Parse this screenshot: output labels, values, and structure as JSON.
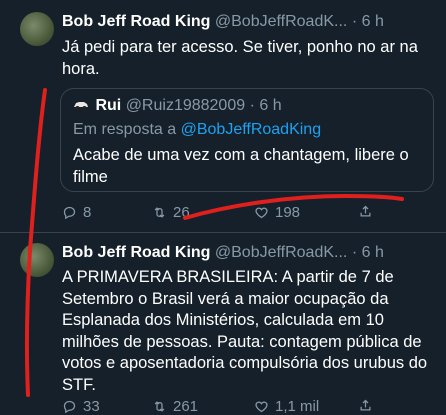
{
  "colors": {
    "background": "#15202b",
    "text": "#ffffff",
    "muted": "#8899a6",
    "accent": "#1da1f2",
    "scribble": "#e0201c"
  },
  "tweet1": {
    "name": "Bob Jeff Road King",
    "handle": "@BobJeffRoadK...",
    "dot": "·",
    "time": "6 h",
    "text": "Já pedi para ter acesso. Se tiver, ponho no ar na hora.",
    "quote": {
      "name": "Rui",
      "handle": "@Ruiz19882009",
      "dot": "·",
      "time": "6 h",
      "reply_prefix": "Em resposta a ",
      "reply_mention": "@BobJeffRoadKing",
      "text": "Acabe de uma vez com a chantagem, libere o filme"
    },
    "replies": "8",
    "retweets": "26",
    "likes": "198"
  },
  "tweet2": {
    "name": "Bob Jeff Road King",
    "handle": "@BobJeffRoadK...",
    "dot": "·",
    "time": "6 h",
    "text": "A PRIMAVERA BRASILEIRA: A partir de 7 de Setembro o Brasil verá a maior ocupação da Esplanada dos Ministérios,  calculada em 10 milhões de pessoas. Pauta: contagem pública de votos e aposentadoria compulsória dos urubus do STF.",
    "replies": "33",
    "retweets": "261",
    "likes": "1,1 mil"
  },
  "icons": {
    "reply": "reply-icon",
    "retweet": "retweet-icon",
    "like": "heart-icon",
    "share": "share-icon"
  }
}
